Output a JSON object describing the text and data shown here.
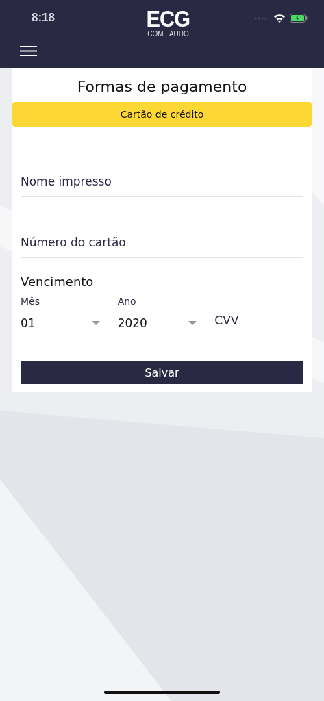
{
  "status_bar": {
    "time": "8:18"
  },
  "header": {
    "logo": "ECG",
    "logo_subtitle": "COM LAUDO"
  },
  "page": {
    "title": "Formas de pagamento",
    "payment_tabs": [
      {
        "label": "Cartão de crédito",
        "selected": true
      }
    ],
    "fields": [
      {
        "placeholder": "Nome impresso"
      },
      {
        "placeholder": "Número do cartão"
      }
    ],
    "expiry": {
      "heading": "Vencimento",
      "selects": [
        {
          "label": "Mês",
          "value": "01"
        },
        {
          "label": "Ano",
          "value": "2020"
        }
      ],
      "cvv": {
        "placeholder": "CVV"
      }
    },
    "save_button": "Salvar"
  }
}
